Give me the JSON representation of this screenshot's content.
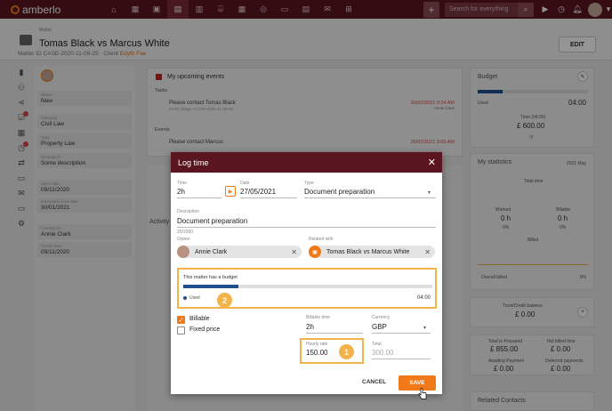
{
  "app": {
    "name": "amberlo"
  },
  "topbar": {
    "search_placeholder": "Search for everything",
    "nav_icons": [
      "home-icon",
      "dashboard-icon",
      "contacts-icon",
      "matters-icon",
      "documents-icon",
      "bank-icon",
      "calendar-icon",
      "support-icon",
      "folder-icon",
      "invoice-icon",
      "mail-icon",
      "grid-icon"
    ]
  },
  "header": {
    "label": "Matter",
    "title": "Tomas Black vs Marcus White",
    "matter_id_label": "Matter ID",
    "matter_id": "CASE-2020-11-09-25",
    "client_label": "Client",
    "client": "Edyth Fae",
    "edit_label": "EDIT"
  },
  "left": {
    "fields": [
      {
        "label": "Status",
        "value": "New"
      },
      {
        "label": "Category",
        "value": "Civil Law"
      },
      {
        "label": "Type",
        "value": "Property Law"
      },
      {
        "label": "Description",
        "value": "Some description"
      },
      {
        "label": "Open date",
        "value": "09/11/2020"
      },
      {
        "label": "Estimated close date",
        "value": "30/01/2021"
      },
      {
        "label": "Created by",
        "value": "Annie Clark"
      },
      {
        "label": "Create date",
        "value": "09/11/2020"
      }
    ]
  },
  "events": {
    "title": "My upcoming events",
    "tasks_label": "Tasks",
    "task": {
      "title": "Please contact Tomas Black",
      "meta": "CIVIC Stage • CASE-2020-11-09-25",
      "date": "26/02/2021 9:24 AM",
      "who": "Annie Clark"
    },
    "events_label": "Events",
    "event": {
      "title": "Please contact Marcus",
      "meta": "",
      "date": "26/02/2021 9:00 AM",
      "who": ""
    },
    "activity_label": "Activity"
  },
  "right": {
    "budget_title": "Budget",
    "used_label": "Used",
    "used_time": "04:00",
    "time_label": "Time (04:00)",
    "time_value": "£ 600.00",
    "stats_title": "My statistics",
    "stats_period": "2021 May",
    "total_time": "Total time",
    "worked_label": "Worked",
    "worked_value": "0 h",
    "worked_pct": "0%",
    "billable_label": "Billable",
    "billable_value": "0 h",
    "billable_pct": "0%",
    "billed_label": "Billed",
    "overall_label": "Overall billed",
    "overall_value": "0%",
    "trust_label": "Trust/Credit balance",
    "trust_value": "£ 0.00",
    "prepared_label": "Total to Prepared",
    "prepared_value": "£ 855.00",
    "notbilled_label": "Not billed time",
    "notbilled_value": "£ 0.00",
    "awaiting_label": "Awaiting Payment",
    "awaiting_value": "£ 0.00",
    "deferred_label": "Deferred payments",
    "deferred_value": "£ 0.00",
    "contacts_title": "Related Contacts"
  },
  "dialog": {
    "title": "Log time",
    "time_label": "Time",
    "time_value": "2h",
    "date_label": "Date",
    "date_value": "27/05/2021",
    "type_label": "Type",
    "type_value": "Document preparation",
    "description_label": "Description",
    "description_value": "Document preparation",
    "counter": "20/2000",
    "owner_label": "Owner",
    "owner_value": "Annie Clark",
    "related_label": "Related with",
    "related_value": "Tomas Black vs Marcus White",
    "budget_notice": "This matter has a budget",
    "budget_used_label": "Used",
    "budget_used_time": "04:00",
    "budget_fraction": 0.22,
    "billable_label": "Billable",
    "billable_checked": true,
    "fixed_label": "Fixed price",
    "fixed_checked": false,
    "billable_time_label": "Billable time",
    "billable_time_value": "2h",
    "currency_label": "Currency",
    "currency_value": "GBP",
    "hourly_label": "Hourly rate",
    "hourly_value": "150.00",
    "total_label": "Total",
    "total_value": "300.00",
    "cancel_label": "CANCEL",
    "save_label": "SAVE"
  },
  "callouts": {
    "one": "1",
    "two": "2"
  },
  "colors": {
    "brand": "#5a1620",
    "accent": "#f07a1a",
    "highlight": "#f3b24a",
    "bar": "#1f4f8f"
  }
}
